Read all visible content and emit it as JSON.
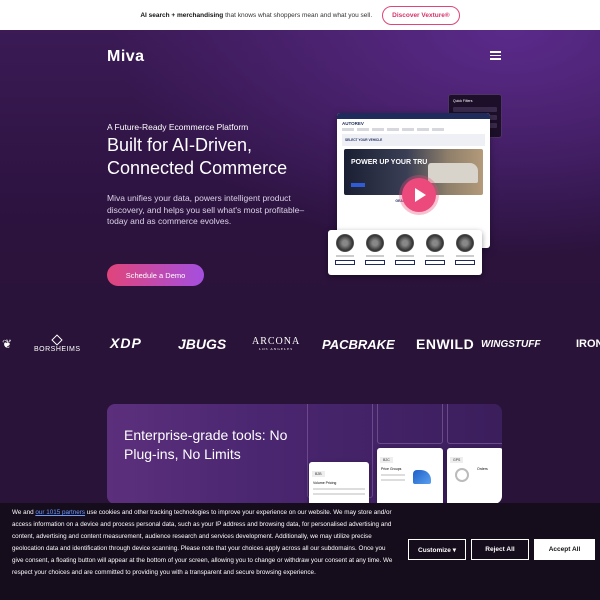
{
  "topbar": {
    "bold_text": "AI search + merchandising",
    "rest_text": "that knows what shoppers mean and what you sell.",
    "button_label": "Discover Vexture®"
  },
  "header": {
    "logo": "Miva"
  },
  "hero": {
    "eyebrow": "A Future-Ready Ecommerce Platform",
    "headline": "Built for AI-Driven, Connected Commerce",
    "subtext": "Miva unifies your data, powers intelligent product discovery, and helps you sell what's most profitable–today and as commerce evolves.",
    "cta_label": "Schedule a Demo",
    "mockup": {
      "brand": "AUTOREV",
      "filter_label": "SELECT YOUR VEHICLE",
      "banner_title": "POWER UP YOUR TRU",
      "section_label": "GEAR UP YOUR RIDE",
      "side_panel_title": "Quick Filters"
    }
  },
  "brands": {
    "borsheims": "BORSHEIMS",
    "xdp": "XDP",
    "jbugs": "JBUGS",
    "arcona": "ARCONA",
    "arcona_sub": "LOS ANGELES",
    "pacbrake": "PACBRAKE",
    "enwild": "ENWILD",
    "wingstuff": "WINGSTUFF",
    "iron": "IRON"
  },
  "enterprise": {
    "title": "Enterprise-grade tools: No Plug-ins, No Limits",
    "shot1_tag": "B2B",
    "shot1_label": "Volume Pricing",
    "shot2_tag": "B2C",
    "shot2_label": "Price Groups",
    "shot3_tag": "GPS",
    "shot3_label": "Orders"
  },
  "cookie": {
    "text_before": "We and ",
    "link_text": "our 1015 partners",
    "text_after": " use cookies and other tracking technologies to improve your experience on our website. We may store and/or access information on a device and process personal data, such as your IP address and browsing data, for personalised advertising and content, advertising and content measurement, audience research and services development. Additionally, we may utilize precise geolocation data and identification through device scanning. Please note that your choices apply across all our subdomains. Once you give consent, a floating button will appear at the bottom of your screen, allowing you to change or withdraw your consent at any time. We respect your choices and are committed to providing you with a transparent and secure browsing experience.",
    "customize_label": "Customize ▾",
    "reject_label": "Reject All",
    "accept_label": "Accept All"
  },
  "colors": {
    "accent_pink": "#e0447a",
    "accent_purple": "#a44fe0",
    "background": "#2a1338",
    "cookie_bg": "#150c1c",
    "link": "#6b9cff"
  },
  "icons": {
    "menu": "hamburger-icon",
    "play": "play-icon",
    "diamond": "diamond-icon"
  }
}
